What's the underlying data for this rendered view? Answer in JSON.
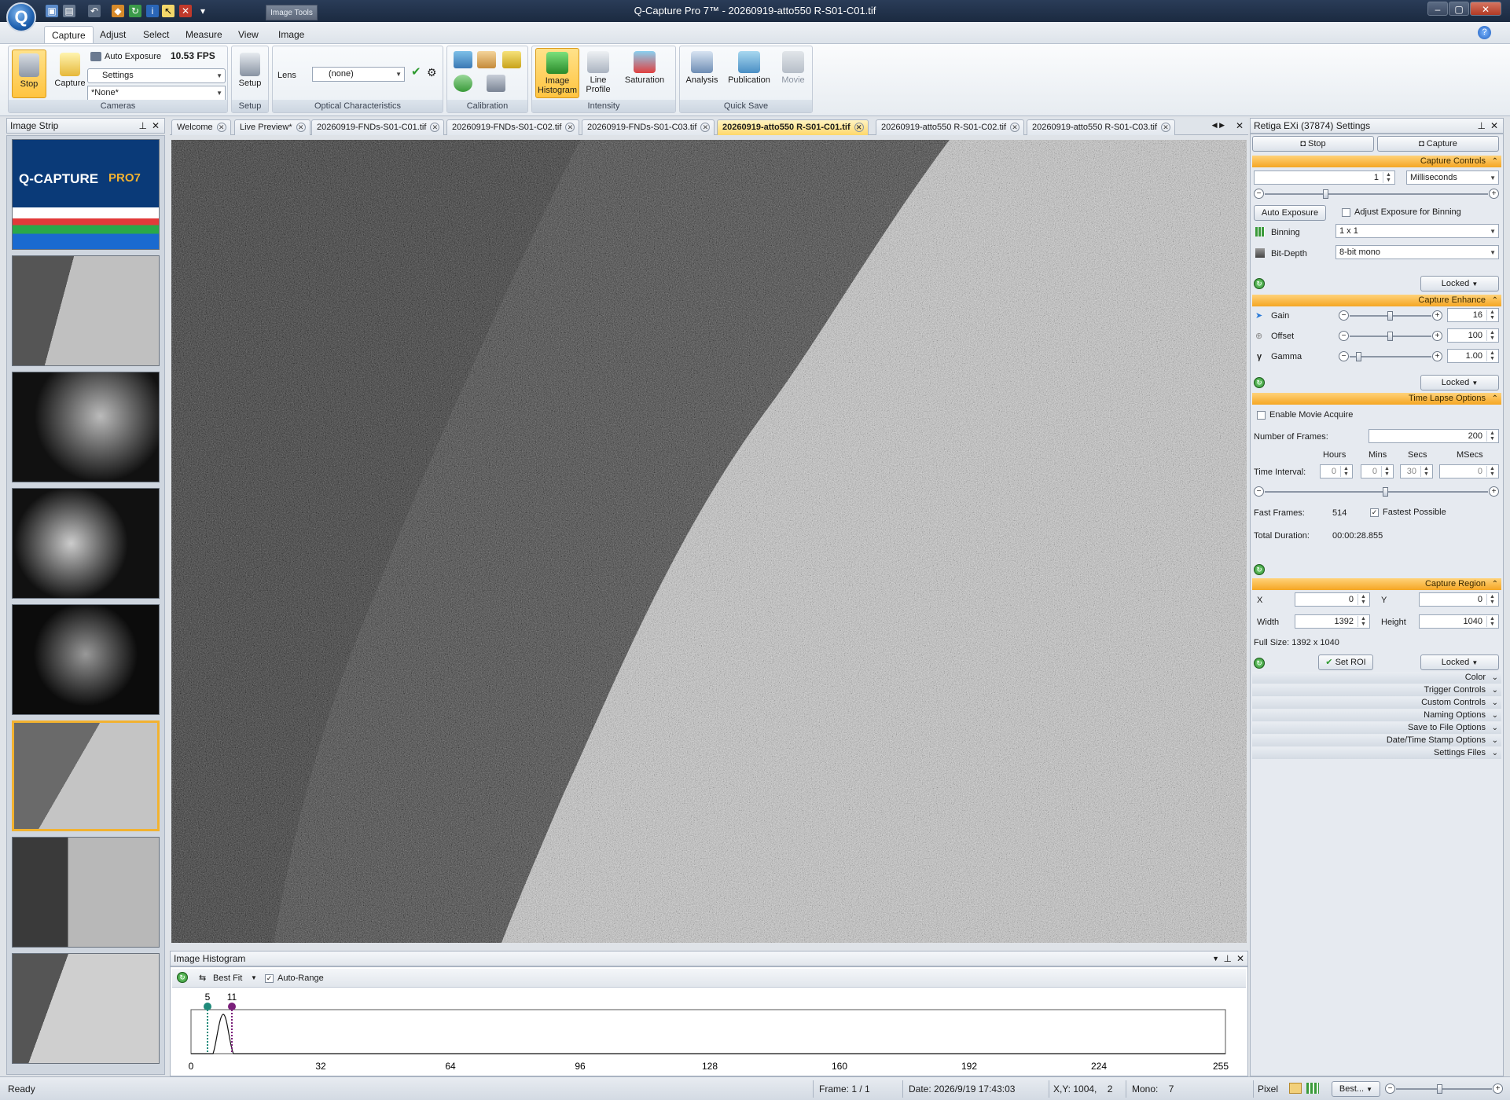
{
  "window": {
    "title": "Q-Capture Pro 7™ - 20260919-atto550 R-S01-C01.tif",
    "context_tab": "Image Tools"
  },
  "menus": [
    "Capture",
    "Adjust",
    "Select",
    "Measure",
    "View",
    "Image"
  ],
  "ribbon": {
    "cameras": {
      "label": "Cameras",
      "stop": "Stop",
      "capture": "Capture",
      "auto_exposure": "Auto Exposure",
      "fps": "10.53 FPS",
      "settings": "Settings",
      "preset": "*None*"
    },
    "setup": {
      "label": "Setup",
      "setup": "Setup"
    },
    "optical": {
      "label": "Optical Characteristics",
      "lens_label": "Lens",
      "lens_value": "(none)"
    },
    "calibration": {
      "label": "Calibration"
    },
    "intensity": {
      "label": "Intensity",
      "image_histogram": "Image Histogram",
      "line_profile": "Line Profile",
      "saturation": "Saturation"
    },
    "quicksave": {
      "label": "Quick Save",
      "analysis": "Analysis",
      "publication": "Publication",
      "movie": "Movie"
    }
  },
  "image_strip": {
    "title": "Image Strip",
    "splash_title": "Q-CAPTURE",
    "splash_pro": "PRO7"
  },
  "doc_tabs": [
    "Welcome",
    "Live Preview*",
    "20260919-FNDs-S01-C01.tif",
    "20260919-FNDs-S01-C02.tif",
    "20260919-FNDs-S01-C03.tif",
    "20260919-atto550 R-S01-C01.tif",
    "20260919-atto550 R-S01-C02.tif",
    "20260919-atto550 R-S01-C03.tif"
  ],
  "active_tab": "20260919-atto550 R-S01-C01.tif",
  "histogram": {
    "title": "Image Histogram",
    "fit": "Best Fit",
    "auto_range": "Auto-Range",
    "low_marker": "5",
    "high_marker": "11",
    "ticks": [
      "0",
      "32",
      "64",
      "96",
      "128",
      "160",
      "192",
      "224",
      "255"
    ]
  },
  "settings": {
    "title": "Retiga EXi (37874) Settings",
    "stop_tab": "Stop",
    "capture_tab": "Capture",
    "capture_controls": {
      "header": "Capture Controls",
      "exposure": "1",
      "unit": "Milliseconds",
      "auto_exposure": "Auto Exposure",
      "adjust_binning": "Adjust Exposure for Binning",
      "binning_label": "Binning",
      "binning": "1 x 1",
      "bitdepth_label": "Bit-Depth",
      "bitdepth": "8-bit mono",
      "locked": "Locked"
    },
    "capture_enhance": {
      "header": "Capture Enhance",
      "gain_label": "Gain",
      "gain": "16",
      "offset_label": "Offset",
      "offset": "100",
      "gamma_label": "Gamma",
      "gamma": "1.00",
      "locked": "Locked"
    },
    "time_lapse": {
      "header": "Time Lapse Options",
      "enable_movie": "Enable Movie Acquire",
      "frames_label": "Number of Frames:",
      "frames": "200",
      "hours": "Hours",
      "mins": "Mins",
      "secs": "Secs",
      "msecs": "MSecs",
      "interval_label": "Time Interval:",
      "h_val": "0",
      "m_val": "0",
      "s_val": "30",
      "ms_val": "0",
      "fast_frames_label": "Fast Frames:",
      "fast_frames": "514",
      "fastest": "Fastest Possible",
      "duration_label": "Total Duration:",
      "duration": "00:00:28.855"
    },
    "capture_region": {
      "header": "Capture Region",
      "x_label": "X",
      "x": "0",
      "y_label": "Y",
      "y": "0",
      "w_label": "Width",
      "w": "1392",
      "h_label": "Height",
      "h": "1040",
      "full_size": "Full Size: 1392 x 1040",
      "set_roi": "Set ROI",
      "locked": "Locked"
    },
    "collapsed": [
      "Color",
      "Trigger Controls",
      "Custom Controls",
      "Naming Options",
      "Save to File Options",
      "Date/Time Stamp Options",
      "Settings Files"
    ]
  },
  "status": {
    "ready": "Ready",
    "frame": "Frame: 1 / 1",
    "date": "Date: 2026/9/19 17:43:03",
    "xy": "X,Y: 1004,    2",
    "mono": "Mono:    7",
    "unit": "Pixel",
    "zoom": "Best..."
  },
  "colors": {
    "accent": "#f5a623",
    "titlebar": "#1b2a40",
    "selection": "#f2b230"
  }
}
